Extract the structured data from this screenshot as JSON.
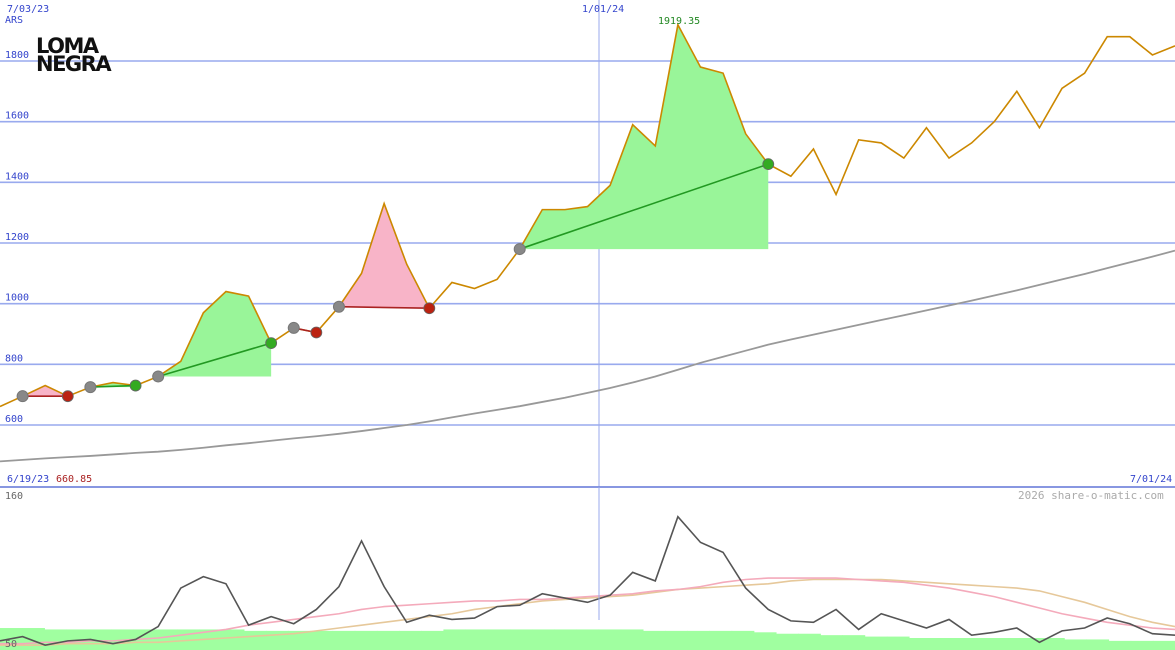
{
  "logo": {
    "line1": "LOMA",
    "line2": "NEGRA"
  },
  "top_labels": {
    "left_date": "7/03/23",
    "mid_date": "1/01/24",
    "currency": "ARS",
    "peak_value": "1919.35"
  },
  "bottom_labels": {
    "left_date": "6/19/23",
    "low_value": "660.85",
    "right_date": "7/01/24",
    "credit": "2026 share-o-matic.com"
  },
  "colors": {
    "price": "#cc8800",
    "ma": "#999999",
    "grid": "#99aaee",
    "gain": "#99f599",
    "loss": "#f8b4c8",
    "gain_line": "#229922",
    "loss_line": "#aa2222",
    "peak_label": "#228822",
    "low_label": "#aa2222",
    "volume": "#a0ffa0",
    "osc": "#555555",
    "pink": "#f4aabb",
    "tan": "#e6c89a"
  },
  "chart_data": {
    "type": "line",
    "title": "",
    "xlabel": "",
    "ylabel": "ARS",
    "x_start": "6/19/23",
    "x_end": "7/01/24",
    "x_ticks": [
      "7/03/23",
      "1/01/24"
    ],
    "y_ticks": [
      600,
      800,
      1000,
      1200,
      1400,
      1600,
      1800
    ],
    "ylim": [
      480,
      1960
    ],
    "grid": true,
    "series": [
      {
        "role": "price",
        "values": [
          660.85,
          695,
          730,
          695,
          725,
          740,
          730,
          760,
          810,
          970,
          1040,
          1025,
          870,
          920,
          905,
          990,
          1100,
          1330,
          1130,
          985,
          1070,
          1050,
          1080,
          1180,
          1310,
          1310,
          1320,
          1390,
          1590,
          1520,
          1919.35,
          1780,
          1760,
          1560,
          1460,
          1420,
          1510,
          1360,
          1540,
          1530,
          1480,
          1580,
          1480,
          1530,
          1600,
          1700,
          1580,
          1710,
          1760,
          1880,
          1880,
          1820,
          1850
        ]
      },
      {
        "role": "moving-average",
        "values": [
          480,
          485,
          490,
          494,
          498,
          503,
          508,
          512,
          518,
          525,
          533,
          540,
          548,
          556,
          563,
          571,
          580,
          590,
          600,
          612,
          625,
          638,
          650,
          662,
          676,
          690,
          706,
          722,
          740,
          760,
          782,
          805,
          825,
          845,
          865,
          882,
          898,
          914,
          930,
          946,
          962,
          978,
          994,
          1010,
          1027,
          1044,
          1062,
          1080,
          1098,
          1117,
          1136,
          1155,
          1175
        ]
      }
    ],
    "trades": [
      {
        "from": 1,
        "to": 3,
        "result": "loss"
      },
      {
        "from": 4,
        "to": 6,
        "result": "gain"
      },
      {
        "from": 7,
        "to": 12,
        "result": "gain"
      },
      {
        "from": 13,
        "to": 14,
        "result": "loss"
      },
      {
        "from": 15,
        "to": 19,
        "result": "loss"
      },
      {
        "from": 23,
        "to": 34,
        "result": "gain"
      }
    ],
    "oscillator": {
      "ylim": [
        50,
        160
      ],
      "y_ticks": [
        50,
        160
      ],
      "line": [
        55,
        58,
        52,
        55,
        56,
        53,
        56,
        65,
        92,
        100,
        95,
        66,
        72,
        67,
        77,
        93,
        125,
        93,
        68,
        73,
        70,
        71,
        79,
        80,
        88,
        85,
        82,
        87,
        103,
        97,
        142,
        124,
        117,
        92,
        77,
        69,
        68,
        77,
        63,
        74,
        69,
        64,
        70,
        59,
        61,
        64,
        54,
        62,
        64,
        71,
        67,
        60,
        59
      ],
      "pink": [
        53,
        53,
        54,
        54,
        55,
        55,
        56,
        57,
        59,
        61,
        63,
        66,
        68,
        70,
        72,
        74,
        77,
        79,
        80,
        81,
        82,
        83,
        83,
        84,
        84,
        85,
        86,
        87,
        88,
        90,
        91,
        93,
        96,
        98,
        99,
        99,
        99,
        99,
        98,
        97,
        96,
        94,
        92,
        89,
        86,
        82,
        78,
        74,
        71,
        68,
        66,
        64,
        63
      ],
      "tan": [
        52,
        52,
        52,
        53,
        53,
        53,
        54,
        54,
        55,
        56,
        57,
        58,
        59,
        60,
        62,
        64,
        66,
        68,
        70,
        72,
        74,
        77,
        79,
        81,
        83,
        84,
        85,
        86,
        87,
        89,
        91,
        92,
        93,
        94,
        95,
        97,
        98,
        98,
        98,
        98,
        97,
        96,
        95,
        94,
        93,
        92,
        90,
        86,
        82,
        77,
        72,
        68,
        65
      ],
      "volume": [
        64,
        64,
        63,
        63,
        63,
        63,
        63,
        63,
        63,
        63,
        63,
        62,
        62,
        62,
        62,
        62,
        62,
        62,
        62,
        62,
        63,
        63,
        63,
        63,
        63,
        63,
        63,
        63,
        63,
        62,
        62,
        62,
        62,
        62,
        61,
        60,
        60,
        59,
        59,
        58,
        58,
        57,
        57,
        57,
        57,
        57,
        57,
        57,
        56,
        56,
        55,
        55,
        55
      ]
    }
  }
}
